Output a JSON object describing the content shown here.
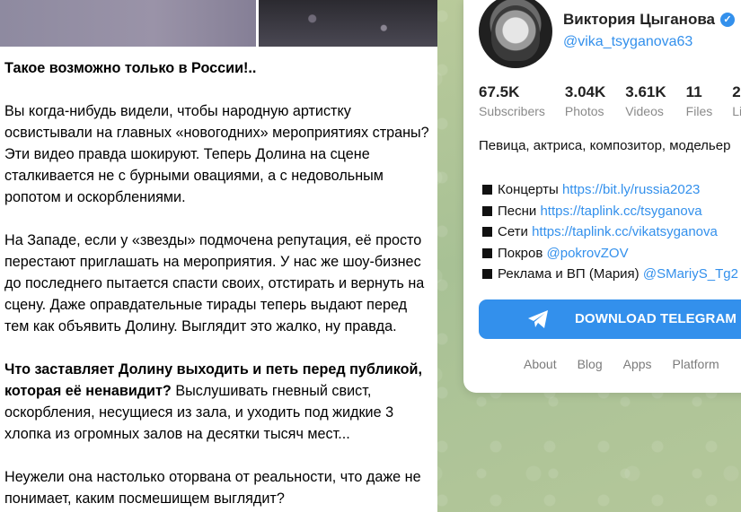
{
  "post": {
    "paragraphs": [
      {
        "bold": "Такое возможно только в России!..",
        "text": ""
      },
      {
        "bold": "",
        "text": "Вы когда-нибудь видели, чтобы народную артистку освистывали на главных «новогодних» мероприятиях страны? Эти видео правда шокируют. Теперь Долина на сцене сталкивается не с бурными овациями, а с недовольным ропотом и оскорблениями."
      },
      {
        "bold": "",
        "text": "На Западе, если у «звезды» подмочена репутация, её просто перестают приглашать на мероприятия. У нас же шоу-бизнес до последнего пытается спасти своих, отстирать и вернуть на сцену. Даже оправдательные тирады теперь выдают перед тем как объявить Долину. Выглядит это жалко, ну правда."
      },
      {
        "bold": "Что заставляет Долину выходить и петь перед публикой, которая её ненавидит?",
        "text": " Выслушивать гневный свист, оскорбления, несущиеся из зала, и уходить под жидкие 3 хлопка из огромных залов на десятки тысяч мест..."
      },
      {
        "bold": "",
        "text": "Неужели она настолько оторвана от реальности, что даже не понимает, каким посмешищем выглядит?"
      }
    ]
  },
  "profile": {
    "name": "Виктория Цыганова",
    "verified_icon": "verified-check-icon",
    "username": "@vika_tsyganova63",
    "stats": [
      {
        "value": "67.5K",
        "label": "Subscribers"
      },
      {
        "value": "3.04K",
        "label": "Photos"
      },
      {
        "value": "3.61K",
        "label": "Videos"
      },
      {
        "value": "11",
        "label": "Files"
      },
      {
        "value": "2",
        "label": "Li"
      }
    ],
    "bio": "Певица, актриса, композитор, модельер",
    "links": [
      {
        "label": "Концерты ",
        "url": "https://bit.ly/russia2023"
      },
      {
        "label": "Песни ",
        "url": "https://taplink.cc/tsyganova"
      },
      {
        "label": "Сети ",
        "url": "https://taplink.cc/vikatsyganova"
      },
      {
        "label": "Покров ",
        "url": "@pokrovZOV"
      },
      {
        "label": "Реклама и ВП (Мария) ",
        "url": "@SMariyS_Tg2"
      }
    ],
    "download_button": "DOWNLOAD TELEGRAM",
    "footer": [
      "About",
      "Blog",
      "Apps",
      "Platform"
    ]
  },
  "colors": {
    "accent": "#3390ec",
    "background_green": "#b5c69a"
  }
}
